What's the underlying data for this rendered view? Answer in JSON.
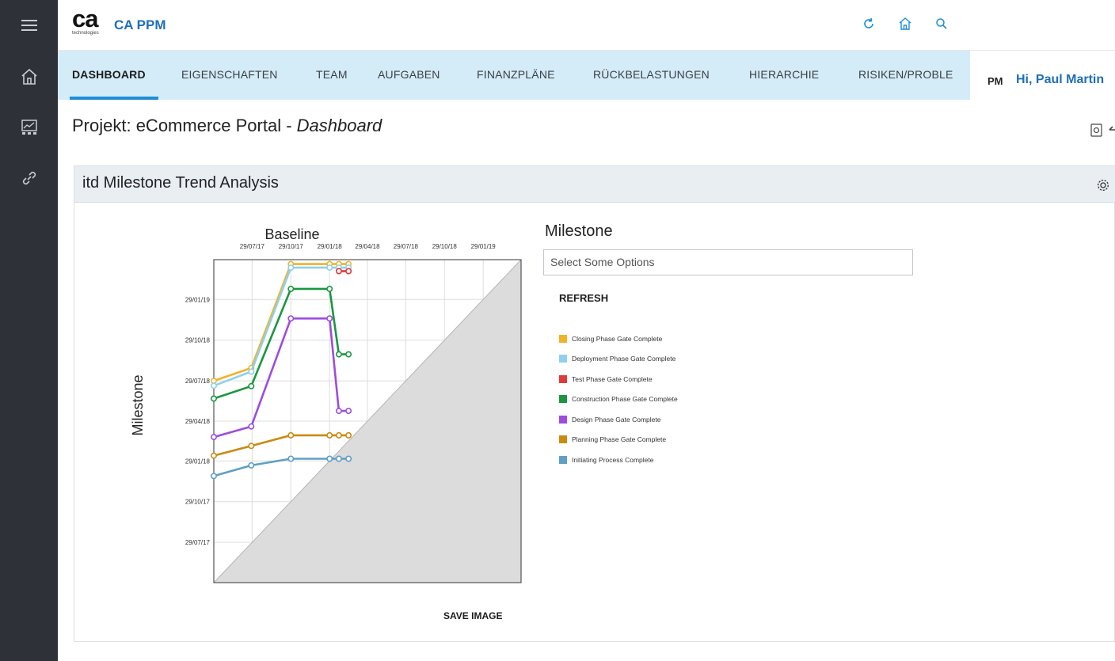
{
  "app": {
    "logo_text": "ca",
    "logo_subtext": "technologies",
    "title": "CA PPM"
  },
  "left_rail": {
    "icons": [
      "menu-icon",
      "home-icon",
      "dashboard-icon",
      "link-icon"
    ]
  },
  "top_icons": [
    "refresh-icon",
    "home-icon",
    "search-icon"
  ],
  "tabs": [
    {
      "label": "DASHBOARD",
      "active": true
    },
    {
      "label": "EIGENSCHAFTEN"
    },
    {
      "label": "TEAM"
    },
    {
      "label": "AUFGABEN"
    },
    {
      "label": "FINANZPLÄNE"
    },
    {
      "label": "RÜCKBELASTUNGEN"
    },
    {
      "label": "HIERARCHIE"
    },
    {
      "label": "RISIKEN/PROBLE"
    }
  ],
  "user": {
    "initials": "PM",
    "greeting": "Hi, Paul Martin"
  },
  "page": {
    "title_prefix": "Projekt: eCommerce Portal - ",
    "title_suffix": "Dashboard"
  },
  "panel": {
    "title": "itd Milestone Trend Analysis",
    "milestone_label": "Milestone",
    "select_placeholder": "Select Some Options",
    "refresh_label": "REFRESH",
    "save_image_label": "SAVE IMAGE"
  },
  "colors": {
    "accent": "#1f8dd6",
    "brand_text": "#1f6fb5",
    "tab_bg": "#d3ecf8",
    "rail_bg": "#2f3138"
  },
  "chart_data": {
    "type": "line",
    "title": "Baseline",
    "ylabel": "Milestone",
    "x_tick_labels": [
      "29/07/17",
      "29/10/17",
      "29/01/18",
      "29/04/18",
      "29/07/18",
      "29/10/18",
      "29/01/19"
    ],
    "y_tick_labels": [
      "29/07/17",
      "29/10/17",
      "29/01/18",
      "29/04/18",
      "29/07/18",
      "29/10/18",
      "29/01/19"
    ],
    "xlim": [
      "2017-04-29",
      "2019-04-29"
    ],
    "ylim": [
      "2017-04-29",
      "2019-04-29"
    ],
    "grid": true,
    "shaded_region": "below diagonal y = x",
    "legend_position": "right",
    "series": [
      {
        "name": "Closing Phase Gate Complete",
        "color": "#f0b429",
        "points": [
          [
            "2017-04-29",
            "2018-07-29"
          ],
          [
            "2017-07-27",
            "2018-08-27"
          ],
          [
            "2017-10-29",
            "2019-04-19"
          ],
          [
            "2018-01-29",
            "2019-04-19"
          ],
          [
            "2018-02-20",
            "2019-04-19"
          ],
          [
            "2018-03-15",
            "2019-04-19"
          ]
        ]
      },
      {
        "name": "Deployment Phase Gate Complete",
        "color": "#8fd0ec",
        "points": [
          [
            "2017-04-29",
            "2018-07-18"
          ],
          [
            "2017-07-27",
            "2018-08-19"
          ],
          [
            "2017-10-29",
            "2019-04-11"
          ],
          [
            "2018-01-29",
            "2019-04-11"
          ],
          [
            "2018-02-20",
            "2019-04-11"
          ],
          [
            "2018-03-15",
            "2019-04-11"
          ]
        ]
      },
      {
        "name": "Test Phase Gate Complete",
        "color": "#e03a3a",
        "points": [
          [
            "2018-02-20",
            "2019-04-03"
          ],
          [
            "2018-03-15",
            "2019-04-03"
          ]
        ]
      },
      {
        "name": "Construction Phase Gate Complete",
        "color": "#1a9641",
        "points": [
          [
            "2017-04-29",
            "2018-06-19"
          ],
          [
            "2017-07-27",
            "2018-07-17"
          ],
          [
            "2017-10-29",
            "2019-02-22"
          ],
          [
            "2018-01-29",
            "2019-02-22"
          ],
          [
            "2018-02-20",
            "2018-09-27"
          ],
          [
            "2018-03-15",
            "2018-09-27"
          ]
        ]
      },
      {
        "name": "Design Phase Gate Complete",
        "color": "#9b4dde",
        "points": [
          [
            "2017-04-29",
            "2018-03-24"
          ],
          [
            "2017-07-27",
            "2018-04-17"
          ],
          [
            "2017-10-29",
            "2018-12-17"
          ],
          [
            "2018-01-29",
            "2018-12-17"
          ],
          [
            "2018-02-20",
            "2018-05-22"
          ],
          [
            "2018-03-15",
            "2018-05-22"
          ]
        ]
      },
      {
        "name": "Planning Phase Gate Complete",
        "color": "#c98a10",
        "points": [
          [
            "2017-04-29",
            "2018-02-10"
          ],
          [
            "2017-07-27",
            "2018-03-04"
          ],
          [
            "2017-10-29",
            "2018-03-28"
          ],
          [
            "2018-01-29",
            "2018-03-28"
          ],
          [
            "2018-02-20",
            "2018-03-28"
          ],
          [
            "2018-03-15",
            "2018-03-28"
          ]
        ]
      },
      {
        "name": "Initiating Process Complete",
        "color": "#5f9fc4",
        "points": [
          [
            "2017-04-29",
            "2017-12-26"
          ],
          [
            "2017-07-27",
            "2018-01-19"
          ],
          [
            "2017-10-29",
            "2018-02-03"
          ],
          [
            "2018-01-29",
            "2018-02-03"
          ],
          [
            "2018-02-20",
            "2018-02-03"
          ],
          [
            "2018-03-15",
            "2018-02-03"
          ]
        ]
      }
    ]
  }
}
